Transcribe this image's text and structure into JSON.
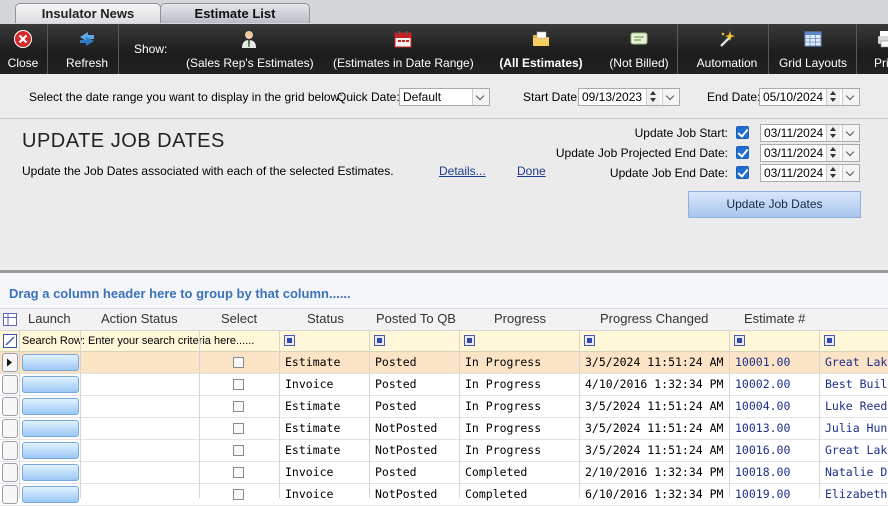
{
  "tabs": [
    {
      "label": "Insulator News",
      "active": false
    },
    {
      "label": "Estimate List",
      "active": true
    }
  ],
  "toolbar": {
    "close": "Close",
    "refresh": "Refresh",
    "show_label": "Show:",
    "sales_rep": "(Sales Rep's Estimates)",
    "date_range": "(Estimates in Date Range)",
    "all_estimates": "(All Estimates)",
    "not_billed": "(Not Billed)",
    "automation": "Automation",
    "grid_layouts": "Grid Layouts",
    "print_partial": "Pri"
  },
  "range": {
    "instruction": "Select the date range you want to display in the grid below:",
    "quick_date_label": "Quick Date:",
    "quick_date_value": "Default",
    "start_date_label": "Start Date:",
    "start_date_value": "09/13/2023",
    "end_date_label": "End Date:",
    "end_date_value": "05/10/2024"
  },
  "update": {
    "title": "UPDATE JOB DATES",
    "description": "Update the Job Dates associated with each of the selected Estimates.",
    "details_link": "Details...",
    "done_link": "Done",
    "job_start_label": "Update Job Start:",
    "job_start_value": "03/11/2024",
    "job_proj_end_label": "Update Job Projected End Date:",
    "job_proj_end_value": "03/11/2024",
    "job_end_label": "Update Job End Date:",
    "job_end_value": "03/11/2024",
    "button": "Update Job Dates"
  },
  "grid": {
    "group_hint": "Drag a column header here to group by that column......",
    "search_hint": "Search Row: Enter your search criteria here......",
    "columns": [
      "Launch",
      "Action Status",
      "Select",
      "Status",
      "Posted To QB",
      "Progress",
      "Progress Changed",
      "Estimate #"
    ],
    "rows": [
      {
        "status": "Estimate",
        "posted": "Posted",
        "progress": "In Progress",
        "changed": "3/5/2024 11:51:24 AM",
        "estimate": "10001.00",
        "customer": "Great Lake"
      },
      {
        "status": "Invoice",
        "posted": "Posted",
        "progress": "In Progress",
        "changed": "4/10/2016 1:32:34 PM",
        "estimate": "10002.00",
        "customer": "Best Builde"
      },
      {
        "status": "Estimate",
        "posted": "Posted",
        "progress": "In Progress",
        "changed": "3/5/2024 11:51:24 AM",
        "estimate": "10004.00",
        "customer": "Luke Reeds"
      },
      {
        "status": "Estimate",
        "posted": "NotPosted",
        "progress": "In Progress",
        "changed": "3/5/2024 11:51:24 AM",
        "estimate": "10013.00",
        "customer": "Julia Hunte"
      },
      {
        "status": "Estimate",
        "posted": "NotPosted",
        "progress": "In Progress",
        "changed": "3/5/2024 11:51:24 AM",
        "estimate": "10016.00",
        "customer": "Great Lake"
      },
      {
        "status": "Invoice",
        "posted": "Posted",
        "progress": "Completed",
        "changed": "2/10/2016 1:32:34 PM",
        "estimate": "10018.00",
        "customer": "Natalie Dav"
      },
      {
        "status": "Invoice",
        "posted": "NotPosted",
        "progress": "Completed",
        "changed": "6/10/2016 1:32:34 PM",
        "estimate": "10019.00",
        "customer": "Elizabeth M"
      }
    ]
  },
  "colors": {
    "toolbar_bg": "#262626",
    "link": "#1e3c8c",
    "group_text": "#3b72b9",
    "selected_row": "#fbe3c6",
    "search_row": "#fff7d8"
  }
}
